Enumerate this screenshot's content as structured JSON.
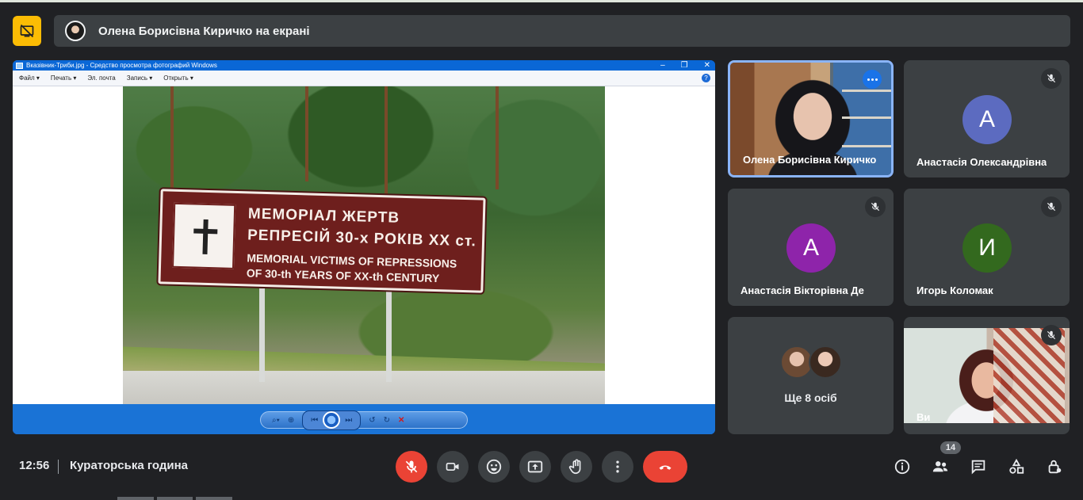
{
  "banner": {
    "text": "Олена Борисівна Киричко на екрані"
  },
  "shared_window": {
    "title": "Вказівник-Триби.jpg - Средство просмотра фотографий Windows",
    "menu": [
      "Файл ▾",
      "Печать ▾",
      "Эл. почта",
      "Запись ▾",
      "Открыть ▾"
    ],
    "controls": [
      "–",
      "❐",
      "✕"
    ],
    "help": "?",
    "sign": {
      "line1": "МЕМОРІАЛ ЖЕРТВ",
      "line2": "РЕПРЕСІЙ 30-х РОКІВ XX ст.",
      "line3": "MEMORIAL VICTIMS OF REPRESSIONS",
      "line4": "OF 30-th YEARS OF XX-th CENTURY"
    }
  },
  "tiles": [
    {
      "name": "Олена Борисівна Киричко",
      "type": "video",
      "active": true
    },
    {
      "name": "Анастасія Олександрівна",
      "type": "avatar",
      "initial": "А",
      "color": "#5c6bc0",
      "muted": true
    },
    {
      "name": "Анастасія Вікторівна Де",
      "type": "avatar",
      "initial": "А",
      "color": "#8e24aa",
      "muted": true
    },
    {
      "name": "Игорь Коломак",
      "type": "avatar",
      "initial": "И",
      "color": "#33691e",
      "muted": true
    },
    {
      "name": "",
      "type": "more",
      "more_text": "Ще 8 осіб"
    },
    {
      "name": "Ви",
      "type": "video",
      "muted": true
    }
  ],
  "bottom_bar": {
    "time": "12:56",
    "meeting_title": "Кураторська година",
    "participants_count": "14"
  },
  "colors": {
    "accent_yellow": "#fbbc04",
    "end_call_red": "#ea4335",
    "active_border": "#8ab4f8",
    "surface": "#3c4043",
    "background": "#202124"
  }
}
